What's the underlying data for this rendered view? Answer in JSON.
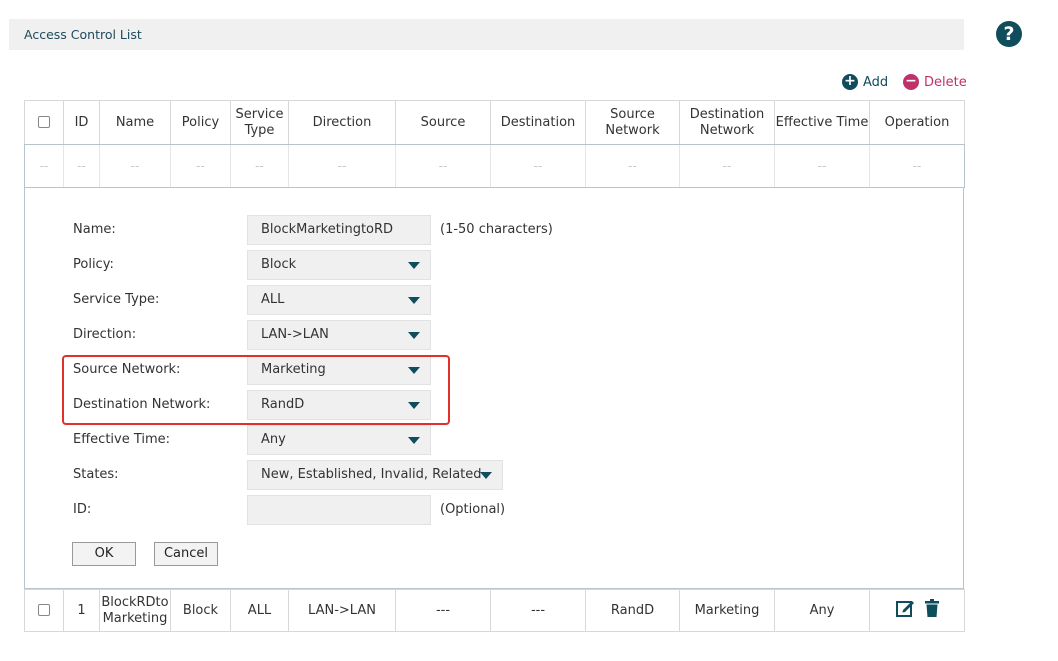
{
  "header": {
    "title": "Access Control List"
  },
  "help": {
    "icon": "help-icon",
    "glyph": "?"
  },
  "toolbar": {
    "add_label": "Add",
    "delete_label": "Delete",
    "add_glyph": "+",
    "delete_glyph": "−"
  },
  "table": {
    "columns": [
      "ID",
      "Name",
      "Policy",
      "Service Type",
      "Direction",
      "Source",
      "Destination",
      "Source Network",
      "Destination Network",
      "Effective Time",
      "Operation"
    ],
    "empty_cell": "--",
    "rows": [
      {
        "id": "1",
        "name": "BlockRDto Marketing",
        "policy": "Block",
        "service_type": "ALL",
        "direction": "LAN->LAN",
        "source": "---",
        "destination": "---",
        "source_network": "RandD",
        "destination_network": "Marketing",
        "effective_time": "Any"
      }
    ]
  },
  "form": {
    "name": {
      "label": "Name:",
      "value": "BlockMarketingtoRD",
      "hint": "(1-50 characters)"
    },
    "policy": {
      "label": "Policy:",
      "value": "Block"
    },
    "service_type": {
      "label": "Service Type:",
      "value": "ALL"
    },
    "direction": {
      "label": "Direction:",
      "value": "LAN->LAN"
    },
    "source_network": {
      "label": "Source Network:",
      "value": "Marketing"
    },
    "destination_network": {
      "label": "Destination Network:",
      "value": "RandD"
    },
    "effective_time": {
      "label": "Effective Time:",
      "value": "Any"
    },
    "states": {
      "label": "States:",
      "value": "New, Established, Invalid, Related"
    },
    "id": {
      "label": "ID:",
      "value": "",
      "hint": "(Optional)"
    },
    "ok_label": "OK",
    "cancel_label": "Cancel"
  },
  "colors": {
    "accent": "#0f4c5c",
    "delete": "#c0306a",
    "highlight": "#e0302a"
  }
}
